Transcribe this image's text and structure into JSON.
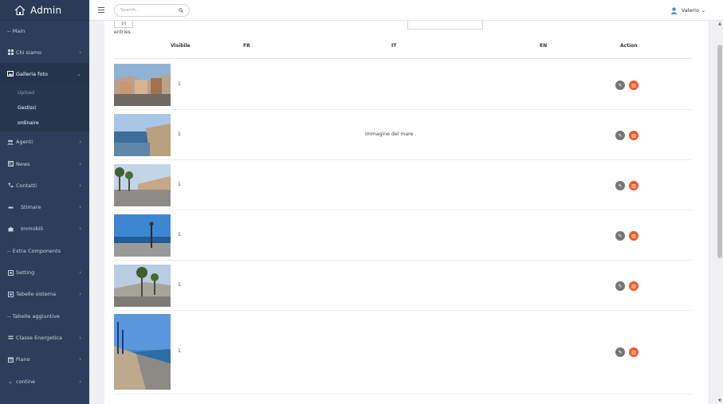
{
  "brand": {
    "title": "Admin"
  },
  "header": {
    "search_placeholder": "Search..",
    "user_name": "Valerio"
  },
  "sidebar": {
    "items": [
      {
        "label": "-- Main"
      },
      {
        "label": "Chi siamo",
        "icon": "grid-icon"
      },
      {
        "label": "Galleria foto",
        "icon": "image-icon",
        "expanded": true
      },
      {
        "label": "Agenti",
        "icon": "users-icon"
      },
      {
        "label": "News",
        "icon": "newspaper-icon"
      },
      {
        "label": "Contatti",
        "icon": "phone-icon"
      },
      {
        "label": "Stimare",
        "icon": "minus-icon"
      },
      {
        "label": "Immobili",
        "icon": "puzzle-icon"
      },
      {
        "label": "-- Extra Components"
      },
      {
        "label": "Setting",
        "icon": "square-icon"
      },
      {
        "label": "Tabelle sistema",
        "icon": "square-icon"
      },
      {
        "label": "-- Tabelle aggiuntive"
      },
      {
        "label": "Classe Energetica",
        "icon": "lines-icon"
      },
      {
        "label": "Piano",
        "icon": "calendar-icon"
      },
      {
        "label": "contine",
        "icon": "chevron-icon"
      }
    ],
    "submenu": [
      {
        "label": "Upload"
      },
      {
        "label": "Gestisci"
      },
      {
        "label": "ordinaire"
      }
    ]
  },
  "table": {
    "length_value": "10",
    "length_label": "entries",
    "columns": [
      "Visibile",
      "FR",
      "IT",
      "EN",
      "Action"
    ],
    "rows": [
      {
        "visible": "1",
        "fr": "",
        "it": "",
        "en": ""
      },
      {
        "visible": "1",
        "fr": "",
        "it": "immagine del mare",
        "en": ""
      },
      {
        "visible": "1",
        "fr": "",
        "it": "",
        "en": ""
      },
      {
        "visible": "1",
        "fr": "",
        "it": "",
        "en": ""
      },
      {
        "visible": "1",
        "fr": "",
        "it": "",
        "en": ""
      },
      {
        "visible": "1",
        "fr": "",
        "it": "",
        "en": ""
      }
    ]
  },
  "colors": {
    "sidebar_bg": "#2c3e5c",
    "edit_button": "#757575",
    "delete_button": "#ef5a2a"
  }
}
